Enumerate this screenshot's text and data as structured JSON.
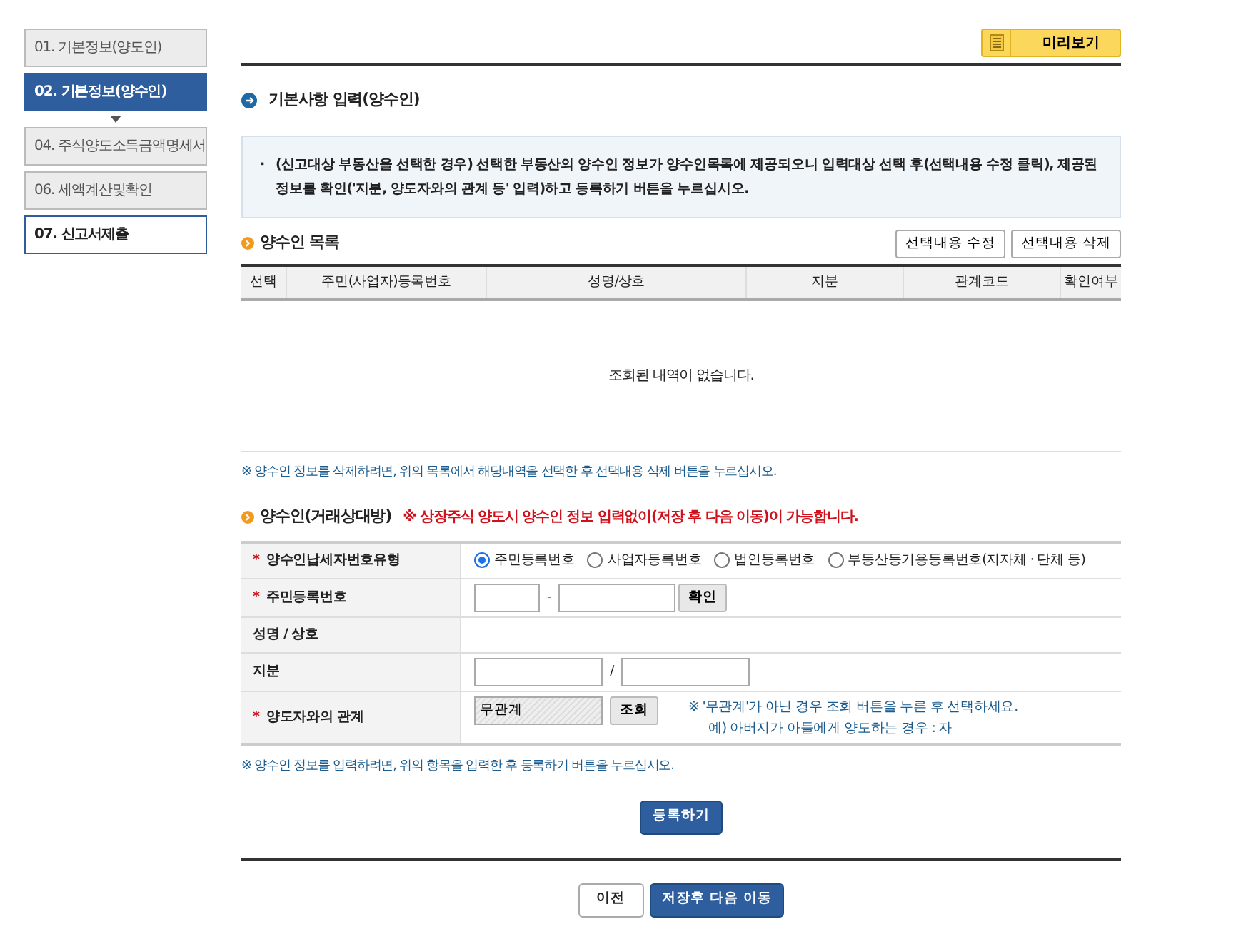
{
  "steps": [
    {
      "label": "01. 기본정보(양도인)",
      "kind": "done",
      "selected": false
    },
    {
      "label": "02. 기본정보(양수인)",
      "kind": "done",
      "selected": true
    },
    {
      "label": "04. 주식양도소득금액명세서",
      "kind": "done",
      "selected": false
    },
    {
      "label": "06. 세액계산및확인",
      "kind": "done",
      "selected": false
    },
    {
      "label": "07. 신고서제출",
      "kind": "todo",
      "selected": false
    }
  ],
  "preview_button": "미리보기",
  "page_title": "기본사항 입력(양수인)",
  "notice_bullet": "·",
  "notice": "(신고대상 부동산을 선택한 경우) 선택한 부동산의 양수인 정보가 양수인목록에 제공되오니 입력대상 선택 후(선택내용 수정 클릭), 제공된 정보를 확인('지분, 양도자와의 관계 등' 입력)하고 등록하기 버튼을 누르십시오.",
  "list": {
    "title": "양수인 목록",
    "buttons": [
      "선택내용 수정",
      "선택내용 삭제"
    ],
    "columns": [
      "선택",
      "주민(사업자)등록번호",
      "성명/상호",
      "지분",
      "관계코드",
      "확인여부"
    ],
    "empty_message": "조회된 내역이 없습니다.",
    "note": "※ 양수인 정보를 삭제하려면, 위의 목록에서 해당내역을 선택한 후 선택내용 삭제 버튼을 누르십시오."
  },
  "form": {
    "title": "양수인(거래상대방)",
    "warning": "※ 상장주식 양도시 양수인 정보 입력없이(저장 후 다음 이동)이 가능합니다.",
    "rows": [
      {
        "label": "양수인납세자번호유형",
        "required_mark": "*",
        "kind": "radio",
        "options": [
          {
            "label": "주민등록번호",
            "selected": true
          },
          {
            "label": "사업자등록번호",
            "selected": false
          },
          {
            "label": "법인등록번호",
            "selected": false
          },
          {
            "label": "부동산등기용등록번호(지자체 · 단체 등)",
            "selected": false
          }
        ]
      },
      {
        "label": "주민등록번호",
        "required_mark": "*",
        "kind": "rrn",
        "separator": "-",
        "button": "확인"
      },
      {
        "label": "성명 / 상호",
        "kind": "empty"
      },
      {
        "label": "지분",
        "kind": "share",
        "separator": "/"
      },
      {
        "label": "양도자와의 관계",
        "required_mark": "*",
        "kind": "relation",
        "value": "무관계",
        "button": "조회",
        "hints": [
          "※ '무관계'가 아닌 경우 조회 버튼을 누른 후 선택하세요.",
          "예) 아버지가 아들에게 양도하는 경우 : 자"
        ]
      }
    ],
    "note": "※ 양수인 정보를 입력하려면, 위의 항목을 입력한 후 등록하기 버튼을 누르십시오.",
    "register_button": "등록하기"
  },
  "footer_buttons": [
    {
      "label": "이전",
      "kind": "secondary"
    },
    {
      "label": "저장후 다음 이동",
      "kind": "primary"
    }
  ]
}
